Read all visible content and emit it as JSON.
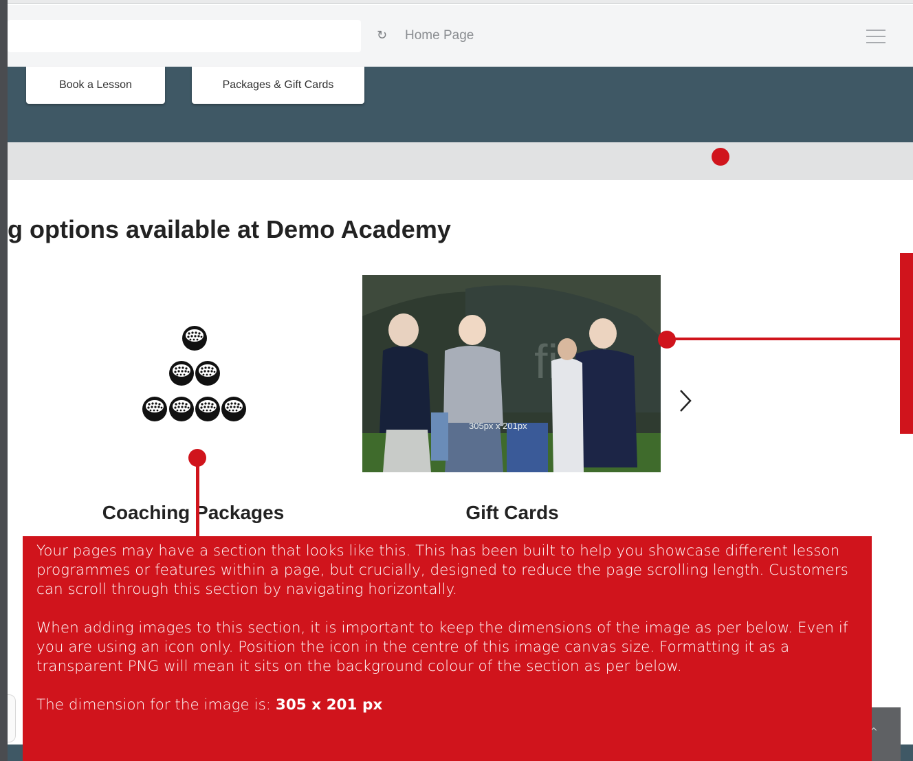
{
  "browser": {
    "page_label": "Home Page"
  },
  "nav": {
    "tabs": [
      {
        "label": "Book a Lesson"
      },
      {
        "label": "Packages & Gift Cards"
      }
    ]
  },
  "section": {
    "heading": "g options available at Demo Academy"
  },
  "cards": [
    {
      "label": "Coaching Packages",
      "media": "golf-balls-icon"
    },
    {
      "label": "Gift Cards",
      "media": "golfers-photo",
      "photo_text": "305px x 201px",
      "photo_watermark": "first"
    }
  ],
  "info_box": {
    "paragraph_1": "Your pages may have a section that looks like this. This has been built to help you showcase different lesson programmes or features within a page, but crucially, designed to reduce the page scrolling length. Customers can scroll through this section by navigating horizontally.",
    "paragraph_2": "When adding images to this section, it is important to keep the dimensions of the image as per below. Even if you are using an icon only. Position the icon in the centre of this image canvas size. Formatting it as a transparent PNG will mean it sits on the background colour of the section as per below.",
    "dimension_prefix": "The dimension for the image is: ",
    "dimension_value": "305 x 201 px"
  },
  "colors": {
    "annotation_red": "#d0141c",
    "navbar": "#3f5865",
    "background": "#ffffff"
  }
}
